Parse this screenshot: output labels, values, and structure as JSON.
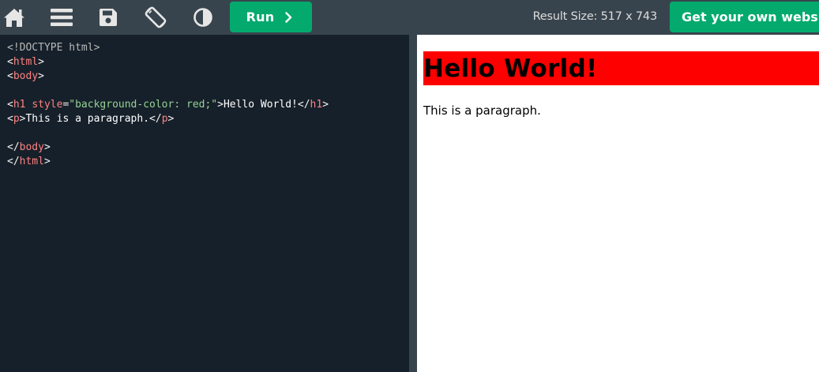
{
  "toolbar": {
    "icons": [
      "home-icon",
      "menu-icon",
      "save-icon",
      "rotate-icon",
      "contrast-icon"
    ],
    "run_label": "Run",
    "result_size": "Result Size: 517 x 743",
    "get_website_label": "Get your own website"
  },
  "editor": {
    "lines": [
      {
        "doctype": "<!DOCTYPE html>"
      },
      {
        "open": "<",
        "tag": "html",
        "close": ">"
      },
      {
        "open": "<",
        "tag": "body",
        "close": ">"
      },
      {},
      {
        "open": "<",
        "tag": "h1",
        "space": " ",
        "attr": "style",
        "eq": "=",
        "value": "\"background-color: red;\"",
        "close": ">",
        "text": "Hello World!",
        "end_open": "</",
        "end_tag": "h1",
        "end_close": ">"
      },
      {
        "open": "<",
        "tag": "p",
        "close": ">",
        "text": "This is a paragraph.",
        "end_open": "</",
        "end_tag": "p",
        "end_close": ">"
      },
      {},
      {
        "open": "</",
        "tag": "body",
        "close": ">"
      },
      {
        "open": "</",
        "tag": "html",
        "close": ">"
      }
    ]
  },
  "result": {
    "heading": "Hello World!",
    "heading_bg": "#ff0000",
    "paragraph": "This is a paragraph."
  },
  "colors": {
    "topbar_bg": "#38444d",
    "accent_green": "#04aa6d",
    "editor_bg": "#16202a",
    "tag_color": "#ff8181",
    "string_color": "#96d294"
  }
}
